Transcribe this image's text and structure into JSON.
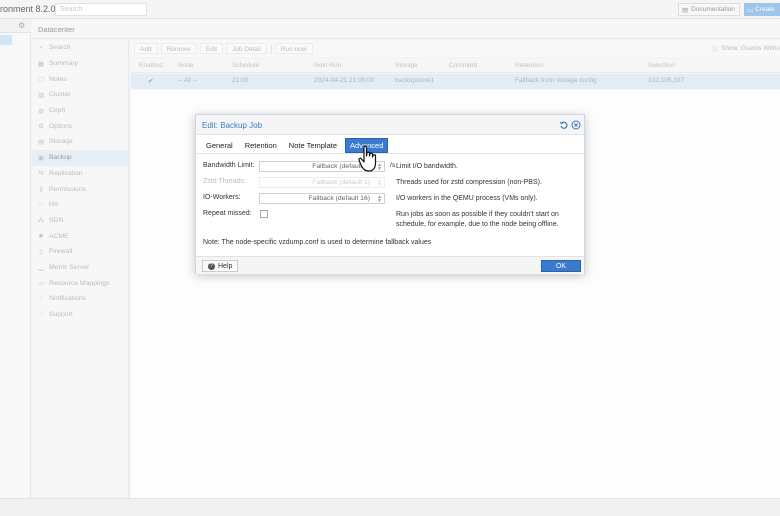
{
  "topbar": {
    "brand": "ronment 8.2.0",
    "search_placeholder": "Search",
    "documentation": "Documentation",
    "create": "Create"
  },
  "breadcrumb": "Datacenter",
  "nav": {
    "items": [
      {
        "label": "Search",
        "icon": "search-icon"
      },
      {
        "label": "Summary",
        "icon": "summary-icon"
      },
      {
        "label": "Notes",
        "icon": "notes-icon"
      },
      {
        "label": "Cluster",
        "icon": "cluster-icon"
      },
      {
        "label": "Ceph",
        "icon": "ceph-icon"
      },
      {
        "label": "Options",
        "icon": "gear-icon"
      },
      {
        "label": "Storage",
        "icon": "database-icon"
      },
      {
        "label": "Backup",
        "icon": "floppy-icon",
        "active": true
      },
      {
        "label": "Replication",
        "icon": "replication-icon"
      },
      {
        "label": "Permissions",
        "icon": "key-icon",
        "expandable": true
      },
      {
        "label": "HA",
        "icon": "heartbeat-icon",
        "expandable": true
      },
      {
        "label": "SDN",
        "icon": "network-icon",
        "expandable": true
      },
      {
        "label": "ACME",
        "icon": "certificate-icon"
      },
      {
        "label": "Firewall",
        "icon": "shield-icon",
        "expandable": true
      },
      {
        "label": "Metric Server",
        "icon": "chart-icon"
      },
      {
        "label": "Resource Mappings",
        "icon": "mapping-icon"
      },
      {
        "label": "Notifications",
        "icon": "bell-icon"
      },
      {
        "label": "Support",
        "icon": "support-icon"
      }
    ]
  },
  "toolbar": {
    "add": "Add",
    "remove": "Remove",
    "edit": "Edit",
    "job_detail": "Job Detail",
    "run_now": "Run now",
    "show_guests": "Show: Guests Witho"
  },
  "grid": {
    "columns": [
      "Enabled",
      "Node",
      "Schedule",
      "Next Run",
      "Storage",
      "Comment",
      "Retention",
      "Selection"
    ],
    "row": {
      "enabled": "✔",
      "node": "-- All --",
      "schedule": "21:00",
      "next_run": "2024-04-21 21:00:00",
      "storage": "backupstore1",
      "comment": "",
      "retention": "Fallback from storage config",
      "selection": "102,105,107"
    }
  },
  "dialog": {
    "title": "Edit: Backup Job",
    "tabs": [
      "General",
      "Retention",
      "Note Template",
      "Advanced"
    ],
    "active_tab": "Advanced",
    "fields": {
      "bandwidth": {
        "label": "Bandwidth Limit:",
        "value": "Fallback (default 0)",
        "unit": "/s",
        "help": "Limit I/O bandwidth."
      },
      "zstd": {
        "label": "Zstd Threads:",
        "value": "Fallback (default 1)",
        "help": "Threads used for zstd compression (non-PBS)."
      },
      "io_workers": {
        "label": "IO-Workers:",
        "value": "Fallback (default 16)",
        "help": "I/O workers in the QEMU process (VMs only)."
      },
      "repeat_missed": {
        "label": "Repeat missed:",
        "help": "Run jobs as soon as possible if they couldn't start on schedule, for example, due to the node being offline."
      }
    },
    "note": "Note: The node-specific vzdump.conf is used to determine fallback values",
    "help_button": "Help",
    "ok_button": "OK"
  },
  "colors": {
    "accent": "#3a7bd0",
    "title_blue": "#3a7cc4",
    "selected_row": "#e1ecf6"
  }
}
